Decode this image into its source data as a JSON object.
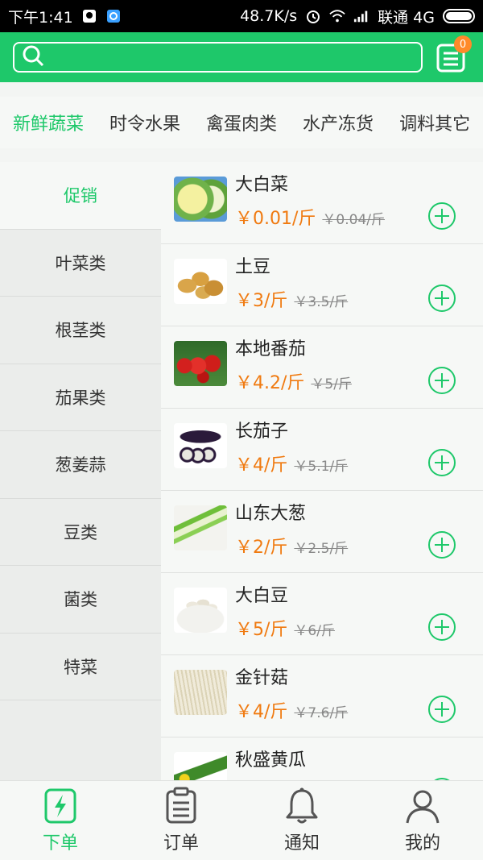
{
  "status_bar": {
    "time": "下午1:41",
    "speed": "48.7K/s",
    "carrier": "联通 4G"
  },
  "header": {
    "search_placeholder": "",
    "cart_count": "0"
  },
  "colors": {
    "accent": "#1ec86a",
    "price": "#f07a10",
    "badge": "#ff8a2a"
  },
  "tabs": [
    "新鲜蔬菜",
    "时令水果",
    "禽蛋肉类",
    "水产冻货",
    "调料其它"
  ],
  "sidebar": [
    "促销",
    "叶菜类",
    "根茎类",
    "茄果类",
    "葱姜蒜",
    "豆类",
    "菌类",
    "特菜"
  ],
  "products": [
    {
      "name": "大白菜",
      "price": "￥0.01/斤",
      "old_price": "￥0.04/斤"
    },
    {
      "name": "土豆",
      "price": "￥3/斤",
      "old_price": "￥3.5/斤"
    },
    {
      "name": "本地番茄",
      "price": "￥4.2/斤",
      "old_price": "￥5/斤"
    },
    {
      "name": "长茄子",
      "price": "￥4/斤",
      "old_price": "￥5.1/斤"
    },
    {
      "name": "山东大葱",
      "price": "￥2/斤",
      "old_price": "￥2.5/斤"
    },
    {
      "name": "大白豆",
      "price": "￥5/斤",
      "old_price": "￥6/斤"
    },
    {
      "name": "金针菇",
      "price": "￥4/斤",
      "old_price": "￥7.6/斤"
    },
    {
      "name": "秋盛黄瓜",
      "price": "",
      "old_price": ""
    }
  ],
  "bottom_nav": [
    "下单",
    "订单",
    "通知",
    "我的"
  ]
}
